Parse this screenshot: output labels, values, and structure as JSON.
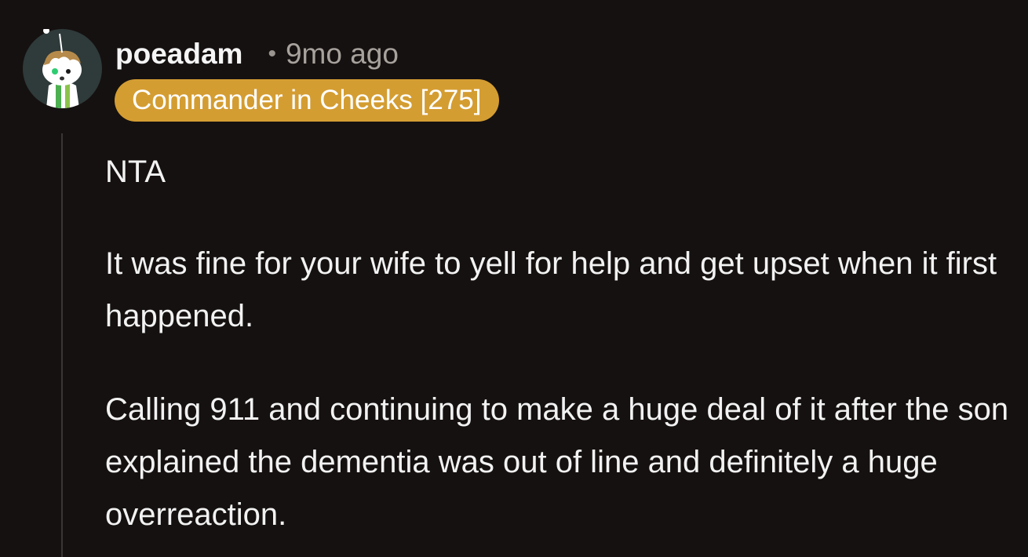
{
  "comment": {
    "author": "poeadam",
    "separator": "•",
    "timestamp": "9mo ago",
    "flair": "Commander in Cheeks [275]",
    "avatar_icon": "snoo-avatar-icon",
    "flair_color": "#d49d32",
    "background_color": "#151110",
    "paragraphs": [
      "NTA",
      "It was fine for your wife to yell for help and get upset when it first happened.",
      "Calling 911 and continuing to make a huge deal of it after the son explained the dementia was out of line and definitely a huge overreaction."
    ]
  }
}
